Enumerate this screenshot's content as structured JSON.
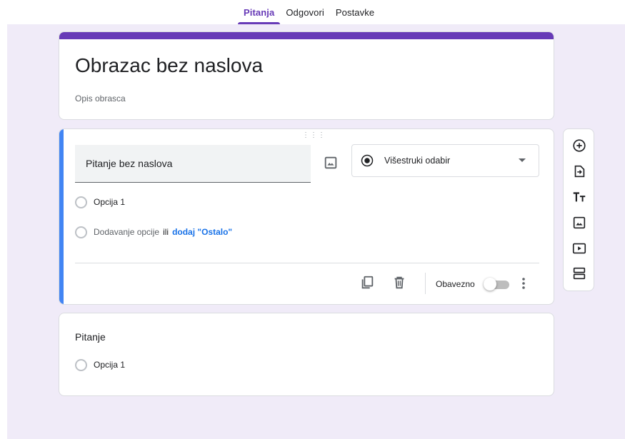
{
  "tabs": [
    {
      "label": "Pitanja",
      "active": true
    },
    {
      "label": "Odgovori",
      "active": false
    },
    {
      "label": "Postavke",
      "active": false
    }
  ],
  "form": {
    "title": "Obrazac bez naslova",
    "description": "Opis obrasca"
  },
  "question": {
    "title": "Pitanje bez naslova",
    "type": "Višestruki odabir",
    "option1": "Opcija 1",
    "add_option": "Dodavanje opcije",
    "or": "ili",
    "add_other": "dodaj \"Ostalo\"",
    "required_label": "Obavezno",
    "required": false
  },
  "question2": {
    "title": "Pitanje",
    "option1": "Opcija 1"
  },
  "colors": {
    "accent": "#673ab7",
    "active_card": "#4285f4",
    "link": "#1a73e8",
    "background": "#f0ebf8"
  },
  "icons": {
    "image": "image-icon",
    "type": "radio-button-checked-icon",
    "duplicate": "copy-icon",
    "delete": "trash-icon",
    "more": "more-vert-icon",
    "toolbar": [
      "add-circle-icon",
      "import-icon",
      "title-icon",
      "image-icon",
      "video-icon",
      "section-icon"
    ]
  }
}
